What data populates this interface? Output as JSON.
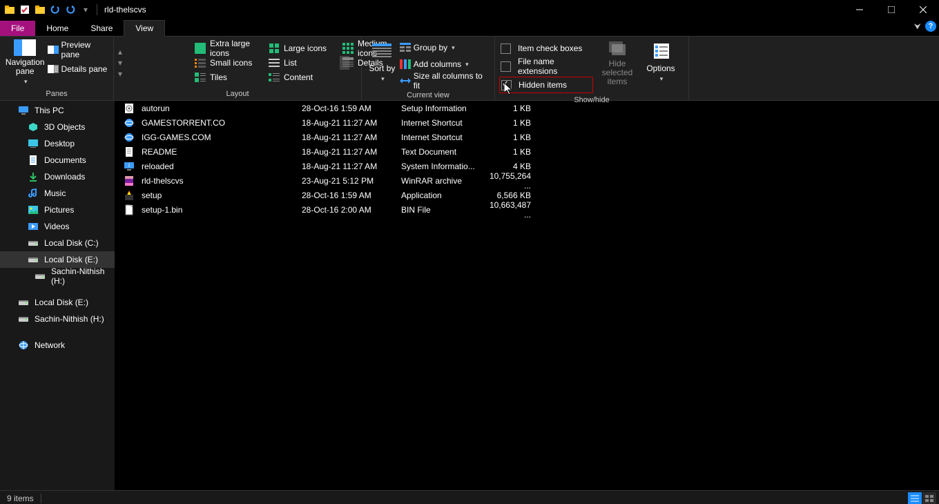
{
  "window": {
    "title": "rld-thelscvs"
  },
  "tabs": {
    "file": "File",
    "home": "Home",
    "share": "Share",
    "view": "View"
  },
  "ribbon": {
    "panes": {
      "navigation": "Navigation pane",
      "preview": "Preview pane",
      "details_pane": "Details pane",
      "group": "Panes"
    },
    "layout": {
      "xl": "Extra large icons",
      "large": "Large icons",
      "medium": "Medium icons",
      "small": "Small icons",
      "list": "List",
      "details": "Details",
      "tiles": "Tiles",
      "content": "Content",
      "group": "Layout"
    },
    "currentview": {
      "sort": "Sort by",
      "groupby": "Group by",
      "addcols": "Add columns",
      "sizeall": "Size all columns to fit",
      "group": "Current view"
    },
    "showhide": {
      "itemcheck": "Item check boxes",
      "fileext": "File name extensions",
      "hidden": "Hidden items",
      "hidesel": "Hide selected items",
      "options": "Options",
      "group": "Show/hide"
    }
  },
  "nav": [
    {
      "label": "This PC",
      "icon": "pc"
    },
    {
      "label": "3D Objects",
      "icon": "3d",
      "indent": true
    },
    {
      "label": "Desktop",
      "icon": "desktop",
      "indent": true
    },
    {
      "label": "Documents",
      "icon": "docs",
      "indent": true
    },
    {
      "label": "Downloads",
      "icon": "dl",
      "indent": true
    },
    {
      "label": "Music",
      "icon": "music",
      "indent": true
    },
    {
      "label": "Pictures",
      "icon": "pics",
      "indent": true
    },
    {
      "label": "Videos",
      "icon": "video",
      "indent": true
    },
    {
      "label": "Local Disk (C:)",
      "icon": "disk",
      "indent": true
    },
    {
      "label": "Local Disk (E:)",
      "icon": "disk",
      "indent": true,
      "active": true
    },
    {
      "label": "Sachin-Nithish (H:)",
      "icon": "disk",
      "indent": true,
      "deep": true
    },
    {
      "label": "Local Disk (E:)",
      "icon": "disk"
    },
    {
      "label": "Sachin-Nithish (H:)",
      "icon": "disk"
    },
    {
      "label": "Network",
      "icon": "net"
    }
  ],
  "files": [
    {
      "name": "autorun",
      "date": "28-Oct-16 1:59 AM",
      "type": "Setup Information",
      "size": "1 KB",
      "i": "ini"
    },
    {
      "name": "GAMESTORRENT.CO",
      "date": "18-Aug-21 11:27 AM",
      "type": "Internet Shortcut",
      "size": "1 KB",
      "i": "url"
    },
    {
      "name": "IGG-GAMES.COM",
      "date": "18-Aug-21 11:27 AM",
      "type": "Internet Shortcut",
      "size": "1 KB",
      "i": "url"
    },
    {
      "name": "README",
      "date": "18-Aug-21 11:27 AM",
      "type": "Text Document",
      "size": "1 KB",
      "i": "txt"
    },
    {
      "name": "reloaded",
      "date": "18-Aug-21 11:27 AM",
      "type": "System Informatio...",
      "size": "4 KB",
      "i": "nfo"
    },
    {
      "name": "rld-thelscvs",
      "date": "23-Aug-21 5:12 PM",
      "type": "WinRAR archive",
      "size": "10,755,264 ...",
      "i": "rar"
    },
    {
      "name": "setup",
      "date": "28-Oct-16 1:59 AM",
      "type": "Application",
      "size": "6,566 KB",
      "i": "exe"
    },
    {
      "name": "setup-1.bin",
      "date": "28-Oct-16 2:00 AM",
      "type": "BIN File",
      "size": "10,663,487 ...",
      "i": "bin"
    }
  ],
  "status": {
    "items": "9 items"
  }
}
